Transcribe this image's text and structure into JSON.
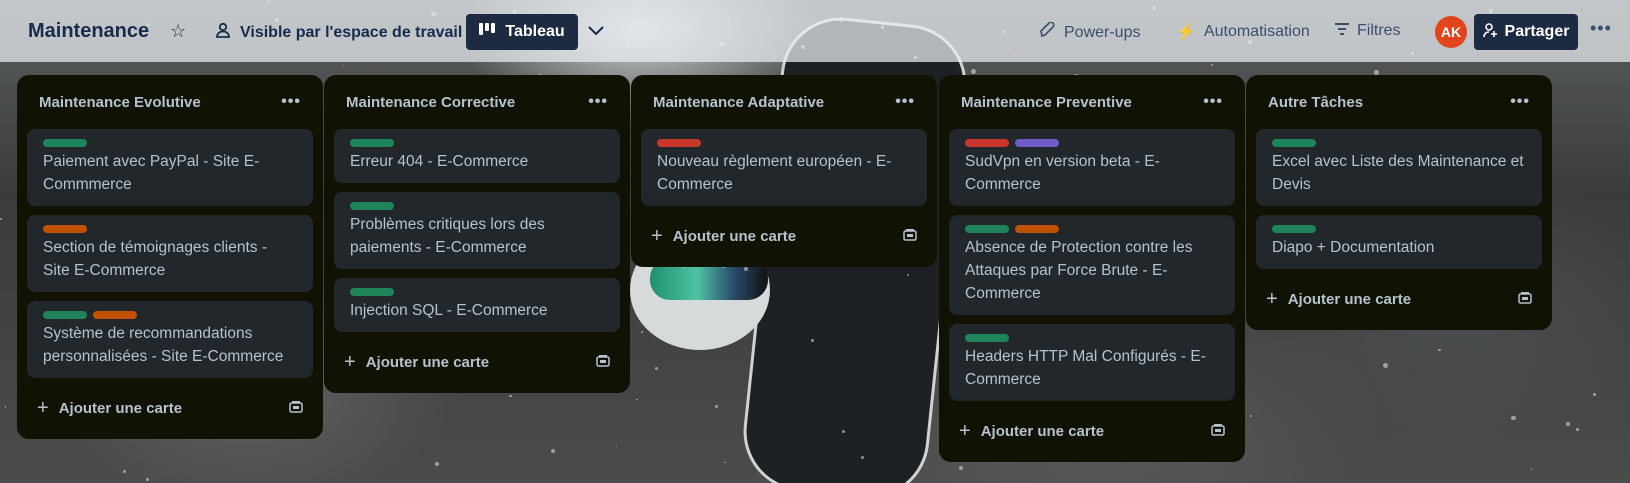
{
  "header": {
    "board_title": "Maintenance",
    "visibility_label": "Visible par l'espace de travail",
    "view_label": "Tableau",
    "powerups_label": "Power-ups",
    "automation_label": "Automatisation",
    "filters_label": "Filtres",
    "avatar_initials": "AK",
    "share_label": "Partager"
  },
  "label_colors": {
    "green": "#1f845a",
    "orange": "#c25100",
    "red": "#c9372c",
    "purple": "#6e5dc6"
  },
  "add_card_label": "Ajouter une carte",
  "lists": [
    {
      "title": "Maintenance Evolutive",
      "cards": [
        {
          "labels": [
            "green"
          ],
          "text": "Paiement avec PayPal - Site E-Commmerce"
        },
        {
          "labels": [
            "orange"
          ],
          "text": "Section de témoignages clients - Site E-Commerce"
        },
        {
          "labels": [
            "green",
            "orange"
          ],
          "text": "Système de recommandations personnalisées - Site E-Commerce"
        }
      ]
    },
    {
      "title": "Maintenance Corrective",
      "cards": [
        {
          "labels": [
            "green"
          ],
          "text": "Erreur 404 - E-Commerce"
        },
        {
          "labels": [
            "green"
          ],
          "text": "Problèmes critiques lors des paiements - E-Commerce"
        },
        {
          "labels": [
            "green"
          ],
          "text": "Injection SQL - E-Commerce"
        }
      ]
    },
    {
      "title": "Maintenance Adaptative",
      "cards": [
        {
          "labels": [
            "red"
          ],
          "text": "Nouveau règlement européen - E-Commerce"
        }
      ]
    },
    {
      "title": "Maintenance Preventive",
      "cards": [
        {
          "labels": [
            "red",
            "purple"
          ],
          "text": "SudVpn en version beta - E-Commerce"
        },
        {
          "labels": [
            "green",
            "orange"
          ],
          "text": "Absence de Protection contre les Attaques par Force Brute - E-Commerce"
        },
        {
          "labels": [
            "green"
          ],
          "text": "Headers HTTP Mal Configurés - E-Commerce"
        }
      ]
    },
    {
      "title": "Autre Tâches",
      "cards": [
        {
          "labels": [
            "green"
          ],
          "text": "Excel avec Liste des Maintenance et Devis"
        },
        {
          "labels": [
            "green"
          ],
          "text": "Diapo + Documentation"
        }
      ]
    }
  ]
}
